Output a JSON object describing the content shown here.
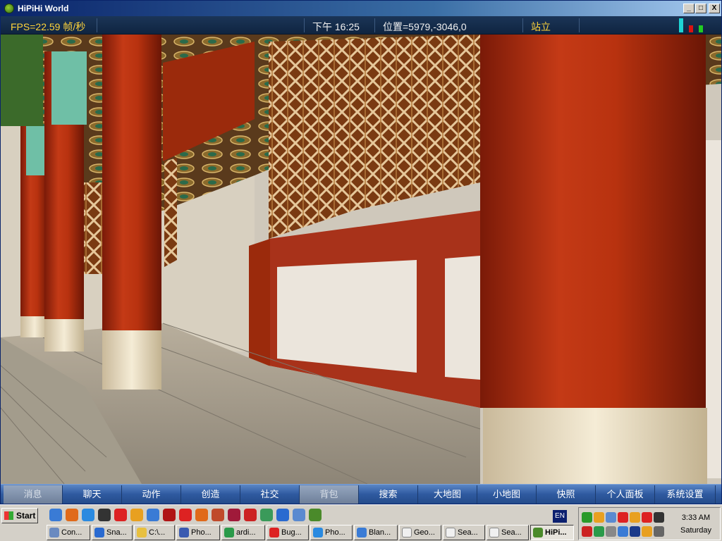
{
  "window": {
    "title": "HiPiHi World",
    "controls": [
      "_",
      "□",
      "X"
    ]
  },
  "status": {
    "fps": "FPS=22.59 帧/秒",
    "time": "下午 16:25",
    "position": "位置=5979,-3046,0",
    "stance": "站立"
  },
  "menu": {
    "items": [
      {
        "label": "消息",
        "dim": true
      },
      {
        "label": "聊天",
        "dim": false
      },
      {
        "label": "动作",
        "dim": false
      },
      {
        "label": "创造",
        "dim": false
      },
      {
        "label": "社交",
        "dim": false
      },
      {
        "label": "背包",
        "dim": true
      },
      {
        "label": "搜索",
        "dim": false
      },
      {
        "label": "大地图",
        "dim": false
      },
      {
        "label": "小地图",
        "dim": false
      },
      {
        "label": "快照",
        "dim": false
      },
      {
        "label": "个人面板",
        "dim": false
      },
      {
        "label": "系统设置",
        "dim": false
      }
    ]
  },
  "taskbar": {
    "start_label": "Start",
    "language": "EN",
    "tasks": [
      {
        "label": "Con...",
        "icon": "window-icon",
        "active": false
      },
      {
        "label": "Sna...",
        "icon": "snagit-icon",
        "active": false
      },
      {
        "label": "C:\\...",
        "icon": "folder-icon",
        "active": false
      },
      {
        "label": "Pho...",
        "icon": "photoshop-icon",
        "active": false
      },
      {
        "label": "ardi...",
        "icon": "messenger-icon",
        "active": false
      },
      {
        "label": "Bug...",
        "icon": "opera-icon",
        "active": false
      },
      {
        "label": "Pho...",
        "icon": "photo-viewer-icon",
        "active": false
      },
      {
        "label": "Blan...",
        "icon": "browser-icon",
        "active": false
      },
      {
        "label": "Geo...",
        "icon": "document-icon",
        "active": false
      },
      {
        "label": "Sea...",
        "icon": "document-icon",
        "active": false
      },
      {
        "label": "Sea...",
        "icon": "document-icon",
        "active": false
      },
      {
        "label": "HiPi...",
        "icon": "hipihi-icon",
        "active": true
      }
    ],
    "clock": {
      "time": "3:33 AM",
      "day": "Saturday"
    }
  }
}
